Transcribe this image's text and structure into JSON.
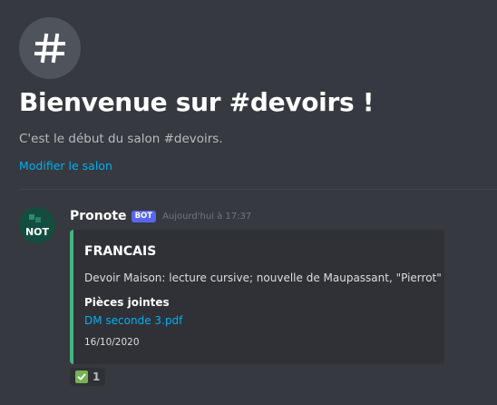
{
  "channel": {
    "hash_icon": "hash-icon",
    "welcome_title": "Bienvenue sur #devoirs !",
    "welcome_subtitle": "C'est le début du salon #devoirs.",
    "edit_link": "Modifier le salon"
  },
  "message": {
    "avatar_text": "NOT",
    "author": "Pronote",
    "bot_badge": "BOT",
    "timestamp": "Aujourd'hui à 17:37",
    "embed": {
      "accent_color": "#43b581",
      "title": "FRANCAIS",
      "description": "Devoir Maison: lecture cursive; nouvelle de Maupassant, \"Pierrot\"",
      "field_name": "Pièces jointes",
      "attachment": "DM seconde 3.pdf",
      "date": "16/10/2020"
    },
    "reaction": {
      "emoji": "white-check-mark-icon",
      "count": "1"
    }
  },
  "colors": {
    "background": "#36393f",
    "embed_background": "#2f3136",
    "link": "#00b0f4",
    "bot_badge": "#5865f2"
  }
}
